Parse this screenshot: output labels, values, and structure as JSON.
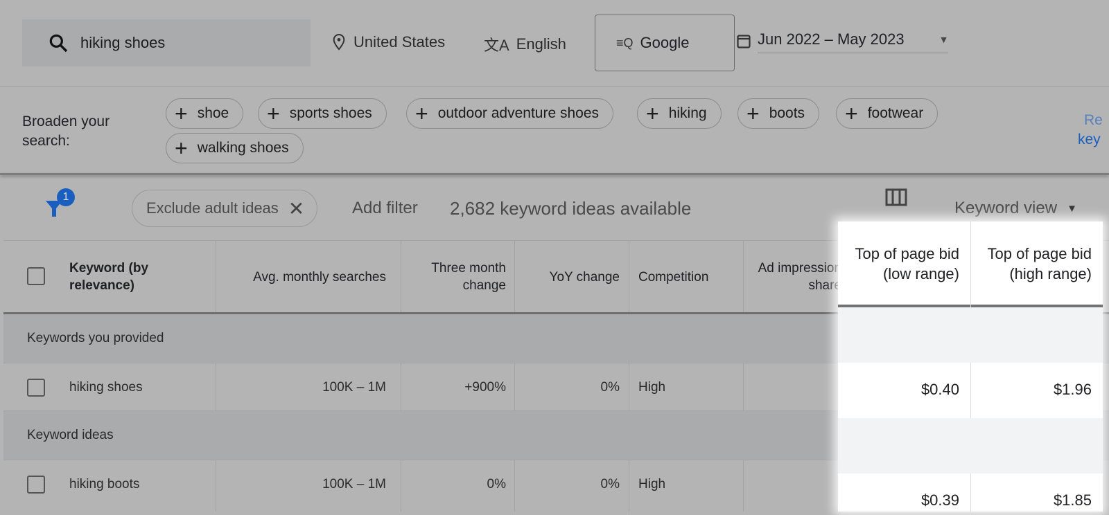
{
  "header": {
    "search_value": "hiking shoes",
    "location": "United States",
    "language": "English",
    "network": "Google",
    "date_range": "Jun 2022 – May 2023"
  },
  "broaden": {
    "label": "Broaden your search:",
    "chips": [
      "shoe",
      "sports shoes",
      "outdoor adventure shoes",
      "hiking",
      "boots",
      "footwear",
      "walking shoes"
    ],
    "refine_link_partial": [
      "Re",
      "key"
    ]
  },
  "toolbar": {
    "filter_badge": "1",
    "exclude_chip": "Exclude adult ideas",
    "add_filter": "Add filter",
    "ideas_count": "2,682 keyword ideas available",
    "view_label": "Keyword view"
  },
  "table": {
    "columns": [
      "Keyword (by relevance)",
      "Avg. monthly searches",
      "Three month change",
      "YoY change",
      "Competition",
      "Ad impression share",
      "Top of page bid (low range)",
      "Top of page bid (high range)"
    ],
    "column_partial": [
      "Ad impressio",
      "shar"
    ],
    "groups": [
      {
        "label": "Keywords you provided",
        "rows": [
          {
            "keyword": "hiking shoes",
            "avg": "100K – 1M",
            "three_month": "+900%",
            "yoy": "0%",
            "competition": "High",
            "low_bid": "$0.40",
            "high_bid": "$1.96"
          }
        ]
      },
      {
        "label": "Keyword ideas",
        "rows": [
          {
            "keyword": "hiking boots",
            "avg": "100K – 1M",
            "three_month": "0%",
            "yoy": "0%",
            "competition": "High",
            "low_bid": "$0.39",
            "high_bid": "$1.85"
          }
        ]
      }
    ]
  },
  "colors": {
    "overlay": "#b4b4b4",
    "accent": "#1a5fbf",
    "highlight": "#ffffff"
  }
}
